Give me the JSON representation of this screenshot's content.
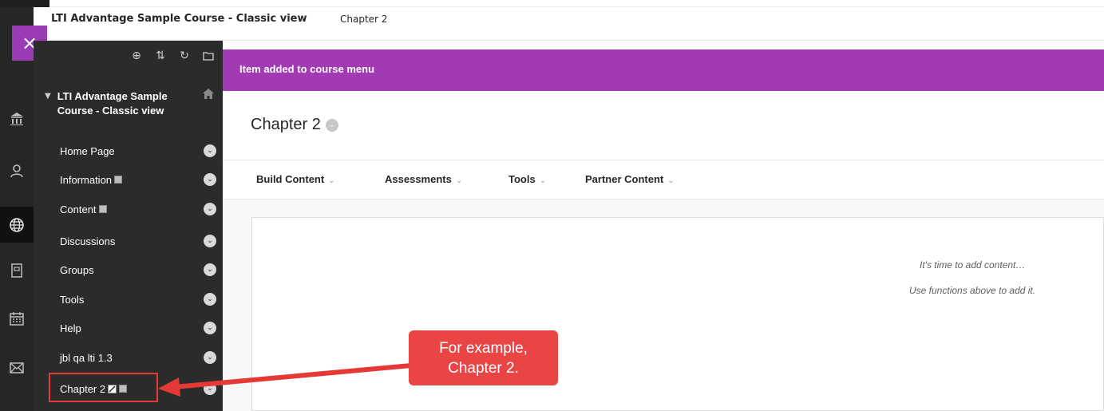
{
  "top_bar": {
    "course_title": "LTI Advantage Sample Course - Classic view",
    "breadcrumb": "Chapter 2"
  },
  "global_nav": {
    "close_label": "×",
    "icons": [
      "institution-icon",
      "profile-icon",
      "globe-icon",
      "courses-icon",
      "calendar-icon",
      "messages-icon"
    ]
  },
  "course_menu": {
    "tools": [
      "⊕",
      "⇅",
      "↻",
      "🗀"
    ],
    "title": "LTI Advantage Sample Course - Classic view",
    "items": [
      {
        "label": "Home Page",
        "has_mini": false
      },
      {
        "label": "Information",
        "has_mini": true
      },
      {
        "label": "Content",
        "has_mini": true
      },
      {
        "label": "Discussions",
        "has_mini": false
      },
      {
        "label": "Groups",
        "has_mini": false
      },
      {
        "label": "Tools",
        "has_mini": false
      },
      {
        "label": "Help",
        "has_mini": false
      },
      {
        "label": "jbl qa lti 1.3",
        "has_mini": false
      },
      {
        "label": "Chapter 2",
        "has_mini": true
      }
    ]
  },
  "banner": {
    "message": "Item added to course menu"
  },
  "main": {
    "heading": "Chapter 2",
    "actions": [
      "Build Content",
      "Assessments",
      "Tools",
      "Partner Content"
    ],
    "empty_line1": "It's time to add content…",
    "empty_line2": "Use functions above to add it."
  },
  "annotation": {
    "line1": "For example,",
    "line2": "Chapter 2."
  },
  "colors": {
    "accent_purple": "#a23ab4",
    "callout_red": "#e94545",
    "sidebar": "#2b2b2b"
  }
}
